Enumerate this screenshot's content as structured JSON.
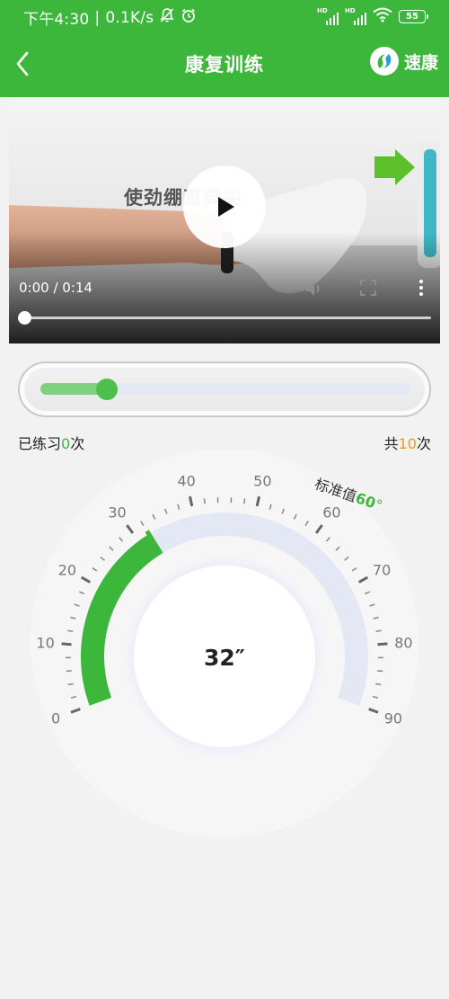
{
  "status_bar": {
    "time": "下午4:30",
    "network_speed": "0.1K/s",
    "signal_1_label": "HD",
    "signal_2_label": "HD",
    "battery": "55",
    "icons": [
      "mute-bell-icon",
      "alarm-icon",
      "signal-icon",
      "signal-icon",
      "wifi-icon",
      "battery-icon"
    ]
  },
  "header": {
    "title": "康复训练",
    "brand_name": "速康",
    "back_icon": "chevron-left-icon"
  },
  "video": {
    "caption": "使劲绷直脚尖",
    "current_time": "0:00",
    "duration": "0:14",
    "time_display": "0:00 / 0:14",
    "progress": 0.0,
    "controls": [
      "play-icon",
      "volume-icon",
      "fullscreen-icon",
      "more-icon"
    ]
  },
  "practice": {
    "progress_fraction": 0.18,
    "done_prefix": "已练习",
    "done_count": "0",
    "done_suffix": "次",
    "total_prefix": "共",
    "total_count": "10",
    "total_suffix": "次"
  },
  "gauge": {
    "current_angle": 32,
    "current_label": "32″",
    "max": 90,
    "tick_labels": [
      "0",
      "10",
      "20",
      "30",
      "40",
      "50",
      "60",
      "70",
      "80",
      "90"
    ],
    "standard_prefix": "标准值",
    "standard_value": "60",
    "standard_unit": "°",
    "standard_angle": 60
  },
  "colors": {
    "brand_green": "#3db63c",
    "count_orange": "#f29a1a",
    "arc_track": "#e4e8f4"
  }
}
